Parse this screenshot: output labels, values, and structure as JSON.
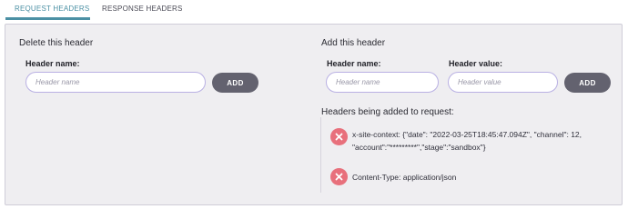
{
  "tabs": {
    "request": "REQUEST HEADERS",
    "response": "RESPONSE HEADERS"
  },
  "delete_section": {
    "title": "Delete this header",
    "name_label": "Header name:",
    "name_placeholder": "Header name",
    "button": "ADD"
  },
  "add_section": {
    "title": "Add this header",
    "name_label": "Header name:",
    "name_placeholder": "Header name",
    "value_label": "Header value:",
    "value_placeholder": "Header value",
    "button": "ADD"
  },
  "pending": {
    "title": "Headers being added to request:",
    "items": [
      {
        "text": "x-site-context: {\"date\": \"2022-03-25T18:45:47.094Z\", \"channel\": 12, \"account\":\"*********\",\"stage\":\"sandbox\"}"
      },
      {
        "text": "Content-Type: application/json"
      }
    ]
  },
  "colors": {
    "accent": "#4b90a4",
    "button": "#63626f",
    "remove": "#e8707c",
    "input_border": "#b9b0e3",
    "panel_bg": "#efeef1"
  },
  "icons": {
    "remove": "close-icon"
  }
}
